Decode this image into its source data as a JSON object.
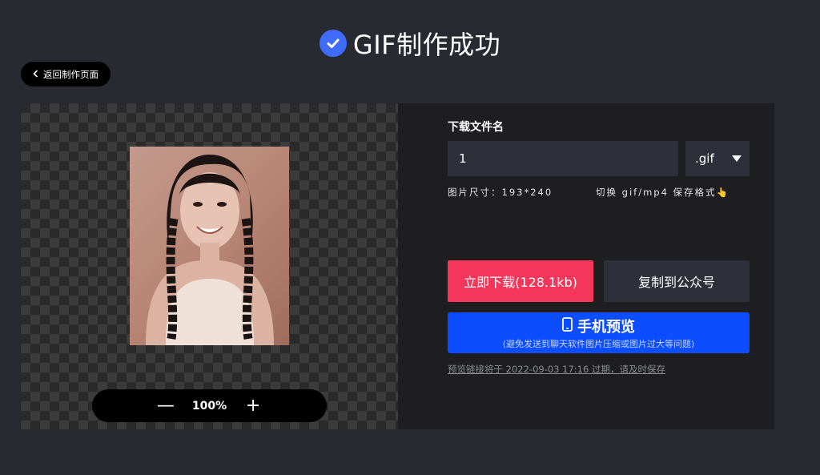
{
  "header": {
    "title": "GIF制作成功",
    "icon": "check-circle-icon",
    "accent_color": "#3f6bff"
  },
  "back_button": {
    "label": "返回制作页面",
    "icon": "chevron-left-icon"
  },
  "preview": {
    "zoom_minus": "—",
    "zoom_value": "100%",
    "zoom_plus": "+"
  },
  "download": {
    "filename_label": "下载文件名",
    "filename_value": "1",
    "format_value": ".gif",
    "image_size": "图片尺寸：193*240",
    "switch_format": "切换 gif/mp4 保存格式",
    "switch_icon": "👆"
  },
  "actions": {
    "download_label": "立即下载(128.1kb)",
    "download_color": "#f4365a",
    "copy_label": "复制到公众号",
    "mobile_preview_label": "手机预览",
    "mobile_preview_icon": "phone-icon",
    "mobile_preview_sub": "(避免发送到聊天软件图片压缩或图片过大等问题)",
    "mobile_color": "#0b4dff"
  },
  "expire_note": "预览链接将于 2022-09-03 17:16 过期，请及时保存"
}
